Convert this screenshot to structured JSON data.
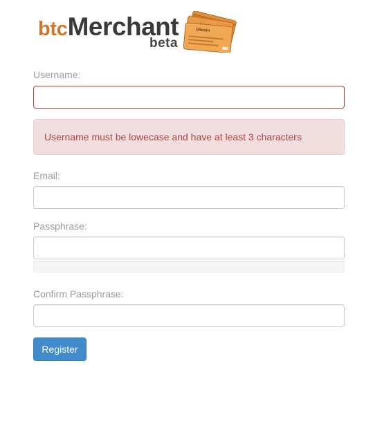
{
  "logo": {
    "prefix": "btc",
    "name": "Merchant",
    "tag": "beta",
    "card_text": "bitcoin"
  },
  "form": {
    "username_label": "Username:",
    "username_value": "",
    "error_message": "Username must be lowecase and have at least 3 characters",
    "email_label": "Email:",
    "email_value": "",
    "passphrase_label": "Passphrase:",
    "passphrase_value": "",
    "passphrase_strength": 0,
    "confirm_label": "Confirm Passphrase:",
    "confirm_value": "",
    "register_label": "Register"
  },
  "colors": {
    "brand_orange": "#d2772a",
    "error_border": "#a94442",
    "error_bg": "#f2dede",
    "primary_button": "#428bca"
  }
}
